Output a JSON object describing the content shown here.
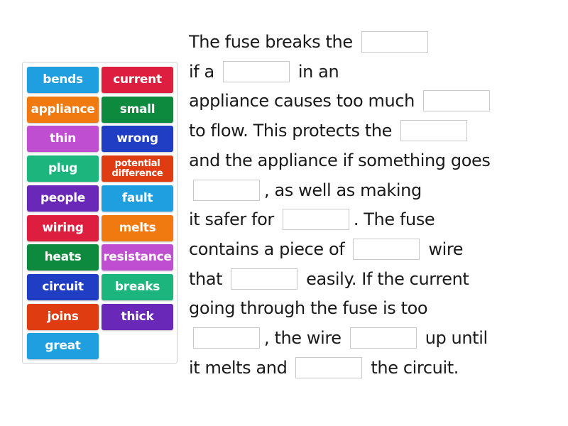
{
  "word_bank": {
    "tiles": [
      {
        "label": "bends",
        "color": "#1f9ee0"
      },
      {
        "label": "current",
        "color": "#dd1e3e"
      },
      {
        "label": "appliance",
        "color": "#f07a10"
      },
      {
        "label": "small",
        "color": "#0e8a3e"
      },
      {
        "label": "thin",
        "color": "#bf4fd0"
      },
      {
        "label": "wrong",
        "color": "#1f3ec4"
      },
      {
        "label": "plug",
        "color": "#1cb57e"
      },
      {
        "label": "potential difference",
        "color": "#e03c12"
      },
      {
        "label": "people",
        "color": "#6a28b8"
      },
      {
        "label": "fault",
        "color": "#1f9ee0"
      },
      {
        "label": "wiring",
        "color": "#dd1e3e"
      },
      {
        "label": "melts",
        "color": "#f07a10"
      },
      {
        "label": "heats",
        "color": "#0e8a3e"
      },
      {
        "label": "resistance",
        "color": "#bf4fd0"
      },
      {
        "label": "circuit",
        "color": "#1f3ec4"
      },
      {
        "label": "breaks",
        "color": "#1cb57e"
      },
      {
        "label": "joins",
        "color": "#e03c12"
      },
      {
        "label": "thick",
        "color": "#6a28b8"
      },
      {
        "label": "great",
        "color": "#1f9ee0"
      }
    ]
  },
  "passage": {
    "lines": [
      [
        "The fuse breaks the",
        "{blank}"
      ],
      [
        "if a",
        "{blank}",
        "in an"
      ],
      [
        "appliance causes too much",
        "{blank}"
      ],
      [
        "to flow. This protects the",
        "{blank}"
      ],
      [
        "and the appliance if something goes"
      ],
      [
        "{blank}",
        ", as well as making"
      ],
      [
        "it safer for",
        "{blank}",
        ". The fuse"
      ],
      [
        "contains a piece of",
        "{blank}",
        "wire"
      ],
      [
        "that",
        "{blank}",
        "easily. If the current"
      ],
      [
        "going through the fuse is too"
      ],
      [
        "{blank}",
        ", the wire",
        "{blank}",
        "up until"
      ],
      [
        "it melts and",
        "{blank}",
        "the circuit."
      ]
    ]
  }
}
